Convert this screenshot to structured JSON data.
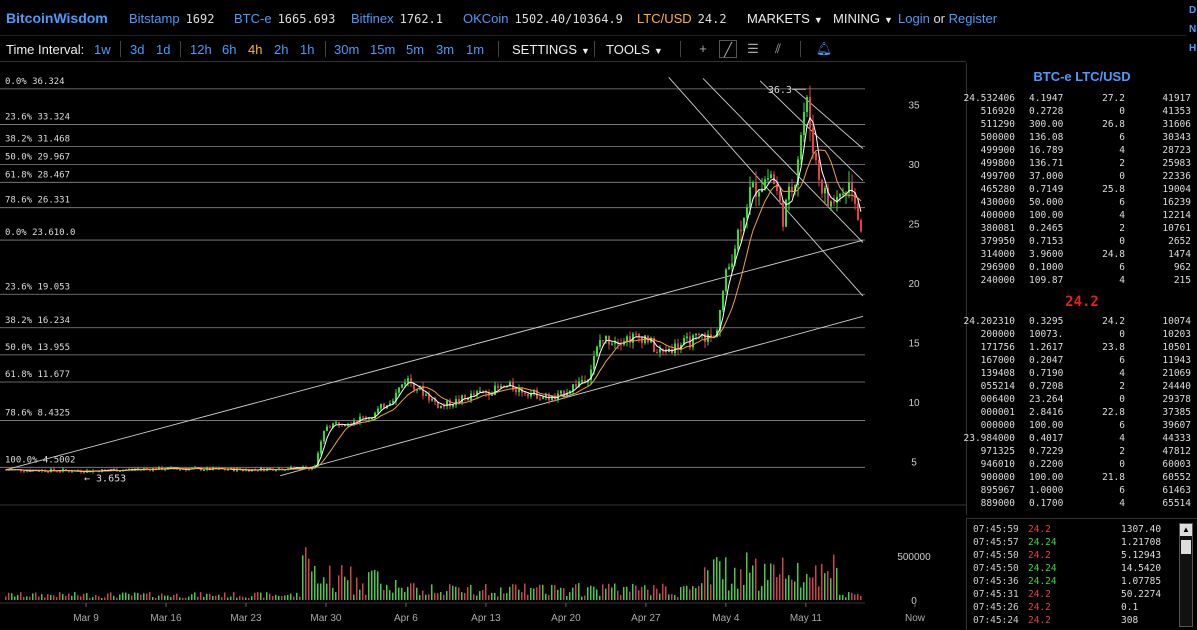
{
  "topbar": {
    "brand": "BitcoinWisdom",
    "exchanges": [
      {
        "name": "Bitstamp",
        "price": "1692"
      },
      {
        "name": "BTC-e",
        "price": "1665.693"
      },
      {
        "name": "Bitfinex",
        "price": "1762.1"
      },
      {
        "name": "OKCoin",
        "price": "1502.40/10364.9"
      },
      {
        "name": "LTC/USD",
        "price": "24.2"
      }
    ],
    "markets_label": "MARKETS",
    "mining_label": "MINING",
    "login_label": "Login",
    "or_label": "or",
    "register_label": "Register"
  },
  "toolbar": {
    "label": "Time Interval:",
    "intervals": [
      "1w",
      "3d",
      "1d",
      "12h",
      "6h",
      "4h",
      "2h",
      "1h",
      "30m",
      "15m",
      "5m",
      "3m",
      "1m"
    ],
    "selected": "4h",
    "settings_label": "SETTINGS",
    "tools_label": "TOOLS"
  },
  "side_strip": [
    "D",
    "N",
    "H"
  ],
  "chart_data": {
    "type": "candlestick",
    "pair": "BTC-e LTC/USD",
    "ylim": [
      1.5,
      38.5
    ],
    "yticks": [
      "35",
      "30",
      "25",
      "20",
      "15",
      "10",
      "5"
    ],
    "volume_ticks": [
      "500000",
      "0"
    ],
    "x_tick_labels": [
      "Mar 9",
      "Mar 16",
      "Mar 23",
      "Mar 30",
      "Apr 6",
      "Apr 13",
      "Apr 20",
      "Apr 27",
      "May 4",
      "May 11",
      "Now"
    ],
    "fib_upper": [
      {
        "label": "0.0% 36.324",
        "value": 36.324
      },
      {
        "label": "23.6% 33.324",
        "value": 33.324
      },
      {
        "label": "38.2% 31.468",
        "value": 31.468
      },
      {
        "label": "50.0% 29.967",
        "value": 29.967
      },
      {
        "label": "61.8% 28.467",
        "value": 28.467
      },
      {
        "label": "78.6% 26.331",
        "value": 26.331
      },
      {
        "label": "0.0% 23.610.0",
        "value": 23.61
      }
    ],
    "fib_lower": [
      {
        "label": "23.6% 19.053",
        "value": 19.053
      },
      {
        "label": "38.2% 16.234",
        "value": 16.234
      },
      {
        "label": "50.0% 13.955",
        "value": 13.955
      },
      {
        "label": "61.8% 11.677",
        "value": 11.677
      },
      {
        "label": "78.6% 8.4325",
        "value": 8.4325
      },
      {
        "label": "100.0% 4.5002",
        "value": 4.5002
      }
    ],
    "annotations": [
      {
        "text": "36.3",
        "value": 36.3
      },
      {
        "text": "3.653",
        "value": 3.653
      }
    ],
    "close_path": [
      {
        "date": "Mar 2",
        "close": 4.3
      },
      {
        "date": "Mar 9",
        "close": 4.2
      },
      {
        "date": "Mar 16",
        "close": 4.4
      },
      {
        "date": "Mar 23",
        "close": 4.3
      },
      {
        "date": "Mar 29",
        "close": 4.5
      },
      {
        "date": "Mar 30",
        "close": 8.0
      },
      {
        "date": "Apr 3",
        "close": 8.8
      },
      {
        "date": "Apr 5",
        "close": 10.5
      },
      {
        "date": "Apr 6",
        "close": 12.0
      },
      {
        "date": "Apr 9",
        "close": 9.6
      },
      {
        "date": "Apr 12",
        "close": 10.6
      },
      {
        "date": "Apr 15",
        "close": 11.3
      },
      {
        "date": "Apr 19",
        "close": 10.2
      },
      {
        "date": "Apr 22",
        "close": 12.3
      },
      {
        "date": "Apr 23",
        "close": 15.2
      },
      {
        "date": "Apr 27",
        "close": 15.5
      },
      {
        "date": "Apr 28",
        "close": 14.1
      },
      {
        "date": "May 2",
        "close": 15.5
      },
      {
        "date": "May 3",
        "close": 15.3
      },
      {
        "date": "May 4",
        "close": 20.5
      },
      {
        "date": "May 6",
        "close": 27.5
      },
      {
        "date": "May 8",
        "close": 29.2
      },
      {
        "date": "May 9",
        "close": 25.6
      },
      {
        "date": "May 10",
        "close": 28.8
      },
      {
        "date": "May 11",
        "close": 35.5
      },
      {
        "date": "May 12",
        "close": 29.4
      },
      {
        "date": "May 13",
        "close": 26.5
      },
      {
        "date": "May 15",
        "close": 28.5
      },
      {
        "date": "May 16",
        "close": 23.8
      }
    ],
    "grid": false
  },
  "orderbook": {
    "title": "BTC-e LTC/USD",
    "asks": [
      {
        "price": "24.532406",
        "amount": "4.1947",
        "sum": "27.2",
        "total": "41917"
      },
      {
        "price": "516920",
        "amount": "0.2728",
        "sum": "0",
        "total": "41353"
      },
      {
        "price": "511290",
        "amount": "300.00",
        "sum": "26.8",
        "total": "31606"
      },
      {
        "price": "500000",
        "amount": "136.08",
        "sum": "6",
        "total": "30343"
      },
      {
        "price": "499900",
        "amount": "16.789",
        "sum": "4",
        "total": "28723"
      },
      {
        "price": "499800",
        "amount": "136.71",
        "sum": "2",
        "total": "25983"
      },
      {
        "price": "499700",
        "amount": "37.000",
        "sum": "0",
        "total": "22336"
      },
      {
        "price": "465280",
        "amount": "0.7149",
        "sum": "25.8",
        "total": "19004"
      },
      {
        "price": "430000",
        "amount": "50.000",
        "sum": "6",
        "total": "16239"
      },
      {
        "price": "400000",
        "amount": "100.00",
        "sum": "4",
        "total": "12214"
      },
      {
        "price": "380081",
        "amount": "0.2465",
        "sum": "2",
        "total": "10761"
      },
      {
        "price": "379950",
        "amount": "0.7153",
        "sum": "0",
        "total": "2652"
      },
      {
        "price": "314000",
        "amount": "3.9600",
        "sum": "24.8",
        "total": "1474"
      },
      {
        "price": "296900",
        "amount": "0.1000",
        "sum": "6",
        "total": "962"
      },
      {
        "price": "240000",
        "amount": "109.87",
        "sum": "4",
        "total": "215"
      }
    ],
    "last": "24.2",
    "bids": [
      {
        "price": "24.202310",
        "amount": "0.3295",
        "sum": "24.2",
        "total": "10074"
      },
      {
        "price": "200000",
        "amount": "10073.",
        "sum": "0",
        "total": "10203"
      },
      {
        "price": "171756",
        "amount": "1.2617",
        "sum": "23.8",
        "total": "10501"
      },
      {
        "price": "167000",
        "amount": "0.2047",
        "sum": "6",
        "total": "11943"
      },
      {
        "price": "139408",
        "amount": "0.7190",
        "sum": "4",
        "total": "21069"
      },
      {
        "price": "055214",
        "amount": "0.7208",
        "sum": "2",
        "total": "24440"
      },
      {
        "price": "006400",
        "amount": "23.264",
        "sum": "0",
        "total": "29378"
      },
      {
        "price": "000001",
        "amount": "2.8416",
        "sum": "22.8",
        "total": "37385"
      },
      {
        "price": "000000",
        "amount": "100.00",
        "sum": "6",
        "total": "39607"
      },
      {
        "price": "23.984000",
        "amount": "0.4017",
        "sum": "4",
        "total": "44333"
      },
      {
        "price": "971325",
        "amount": "0.7229",
        "sum": "2",
        "total": "47812"
      },
      {
        "price": "946010",
        "amount": "0.2200",
        "sum": "0",
        "total": "60003"
      },
      {
        "price": "900000",
        "amount": "100.00",
        "sum": "21.8",
        "total": "60552"
      },
      {
        "price": "895967",
        "amount": "1.0000",
        "sum": "6",
        "total": "61463"
      },
      {
        "price": "889000",
        "amount": "0.1700",
        "sum": "4",
        "total": "65514"
      }
    ]
  },
  "trades": [
    {
      "time": "07:45:59",
      "price": "24.2",
      "amount": "1307.40",
      "side": "sell"
    },
    {
      "time": "07:45:57",
      "price": "24.24",
      "amount": "1.21708",
      "side": "buy"
    },
    {
      "time": "07:45:50",
      "price": "24.2",
      "amount": "5.12943",
      "side": "sell"
    },
    {
      "time": "07:45:50",
      "price": "24.24",
      "amount": "14.5420",
      "side": "buy"
    },
    {
      "time": "07:45:36",
      "price": "24.24",
      "amount": "1.07785",
      "side": "buy"
    },
    {
      "time": "07:45:31",
      "price": "24.2",
      "amount": "50.2274",
      "side": "sell"
    },
    {
      "time": "07:45:26",
      "price": "24.2",
      "amount": "0.1",
      "side": "sell"
    },
    {
      "time": "07:45:24",
      "price": "24.2",
      "amount": "308",
      "side": "sell"
    }
  ],
  "colors": {
    "accent": "#4a9bff",
    "active": "#ffb33b",
    "up": "#33dd33",
    "down": "#e84040"
  }
}
